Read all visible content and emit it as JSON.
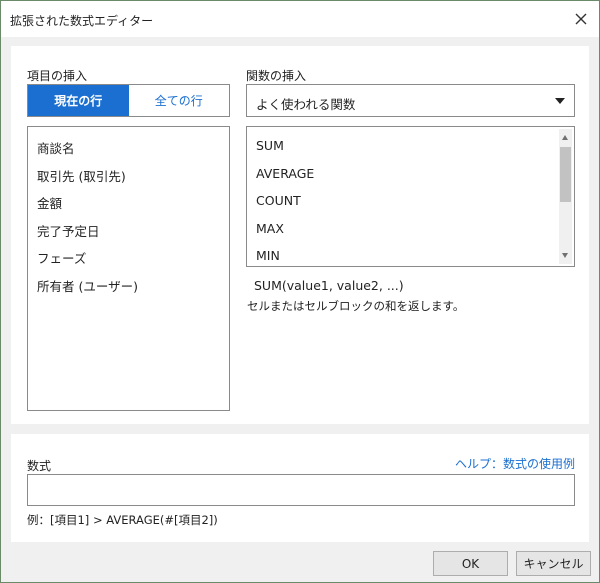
{
  "window": {
    "title": "拡張された数式エディター",
    "close_icon": "close-icon"
  },
  "insert_field": {
    "label": "項目の挿入",
    "tabs": [
      {
        "label": "現在の行",
        "active": true
      },
      {
        "label": "全ての行",
        "active": false
      }
    ],
    "items": [
      "商談名",
      "取引先 (取引先)",
      "金額",
      "完了予定日",
      "フェーズ",
      "所有者 (ユーザー)"
    ]
  },
  "insert_function": {
    "label": "関数の挿入",
    "category_selected": "よく使われる関数",
    "functions": [
      "SUM",
      "AVERAGE",
      "COUNT",
      "MAX",
      "MIN"
    ],
    "signature": "SUM(value1, value2, ...)",
    "description": "セルまたはセルブロックの和を返します。"
  },
  "formula": {
    "label": "数式",
    "help_link": "ヘルプ：数式の使用例",
    "value": "",
    "example": "例：[項目1] > AVERAGE(#[項目2])"
  },
  "buttons": {
    "ok": "OK",
    "cancel": "キャンセル"
  },
  "colors": {
    "accent": "#1b6fd0",
    "panel_bg": "#ffffff",
    "dialog_bg": "#f0f0f0"
  }
}
